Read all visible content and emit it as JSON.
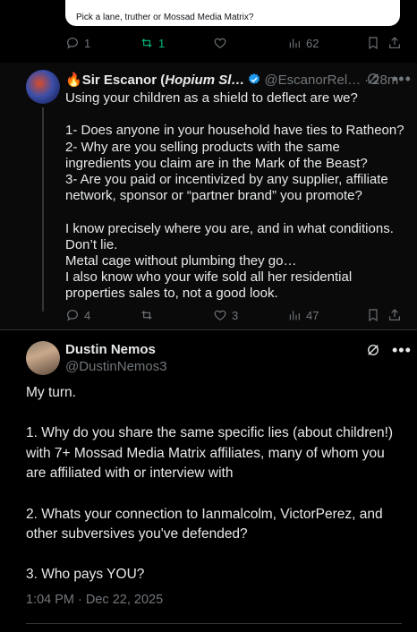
{
  "quoted_card": {
    "text": "Pick a lane, truther or Mossad Media Matrix?"
  },
  "first_action_bar": {
    "replies": "1",
    "reposts": "1",
    "likes": "",
    "views": "62"
  },
  "reply": {
    "emoji": "🔥",
    "display_name": "Sir Escanor (",
    "display_name_tag": "Hopium Sl…",
    "handle": "@EscanorRel…",
    "separator": "·",
    "time": "28m",
    "body": "Using your children as a shield to deflect are we?\n\n1- Does anyone in your household have ties to Ratheon?\n2- Why are you selling products with the same ingredients you claim are in the Mark of the Beast?\n3- Are you paid or incentivized by any supplier, affiliate network, sponsor or “partner brand” you promote?\n\nI know precisely where you are, and in what conditions. Don’t lie.\nMetal cage without plumbing they go…\nI also know who your wife sold all her residential properties sales to, not a good look.",
    "actions": {
      "replies": "4",
      "reposts": "",
      "likes": "3",
      "views": "47"
    }
  },
  "main_post": {
    "display_name": "Dustin Nemos",
    "handle": "@DustinNemos3",
    "body": "My turn.\n\n1. Why do you share the same specific lies (about children!) with 7+ Mossad Media Matrix affiliates, many of whom you are affiliated with or interview with\n\n2. Whats your connection to Ianmalcolm, VictorPerez, and other subversives you've defended?\n\n3. Who pays YOU?",
    "timestamp": "1:04 PM · Dec 22, 2025"
  },
  "colors": {
    "background": "#000000",
    "text": "#e7e9ea",
    "muted": "#71767b",
    "verified": "#1d9bf0",
    "repost_active": "#00ba7c"
  }
}
